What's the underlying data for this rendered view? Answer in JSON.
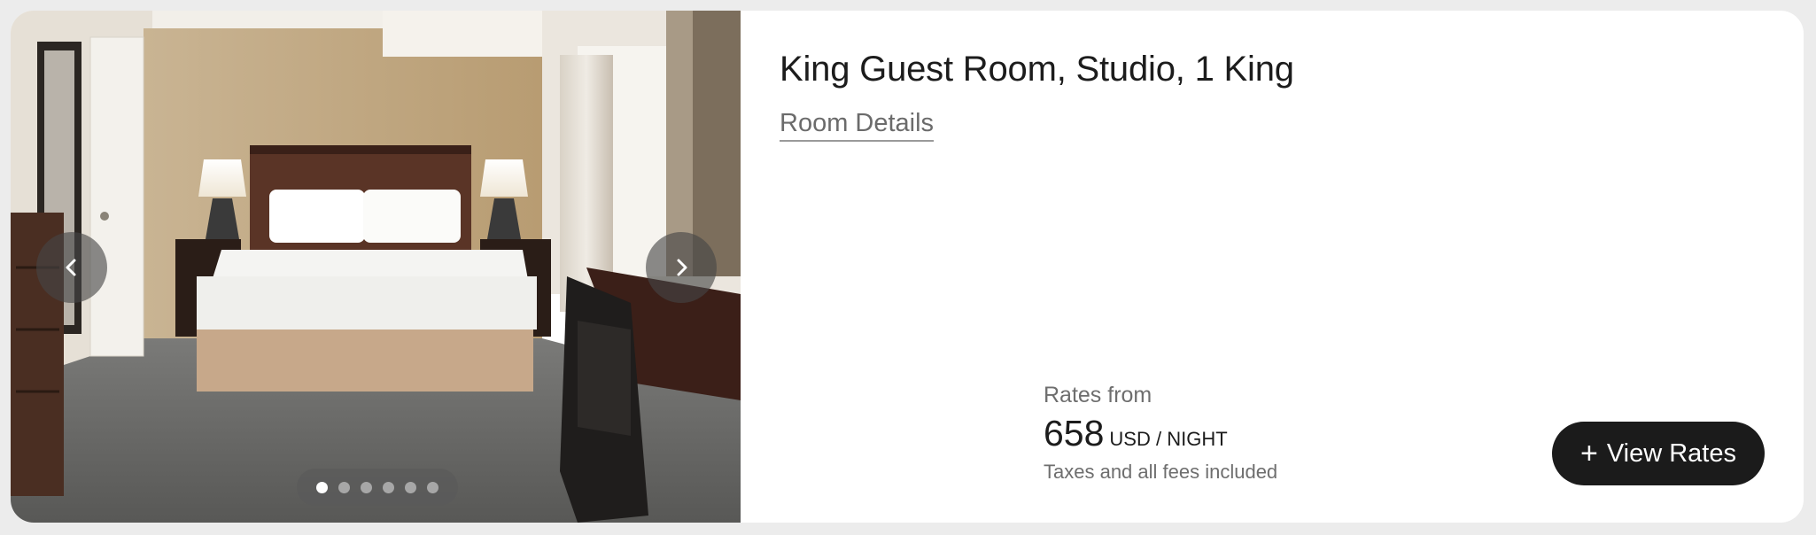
{
  "room": {
    "title": "King Guest Room, Studio, 1 King",
    "details_link": "Room Details"
  },
  "gallery": {
    "photo_count": 6,
    "active_index": 0,
    "prev_icon": "chevron-left-icon",
    "next_icon": "chevron-right-icon"
  },
  "rates": {
    "label": "Rates from",
    "amount": "658",
    "unit": "USD / NIGHT",
    "note": "Taxes and all fees included"
  },
  "cta": {
    "icon": "+",
    "label": "View Rates"
  },
  "colors": {
    "button_bg": "#1b1b1b",
    "title_text": "#1c1c1c",
    "muted_text": "#6e6e6e"
  }
}
